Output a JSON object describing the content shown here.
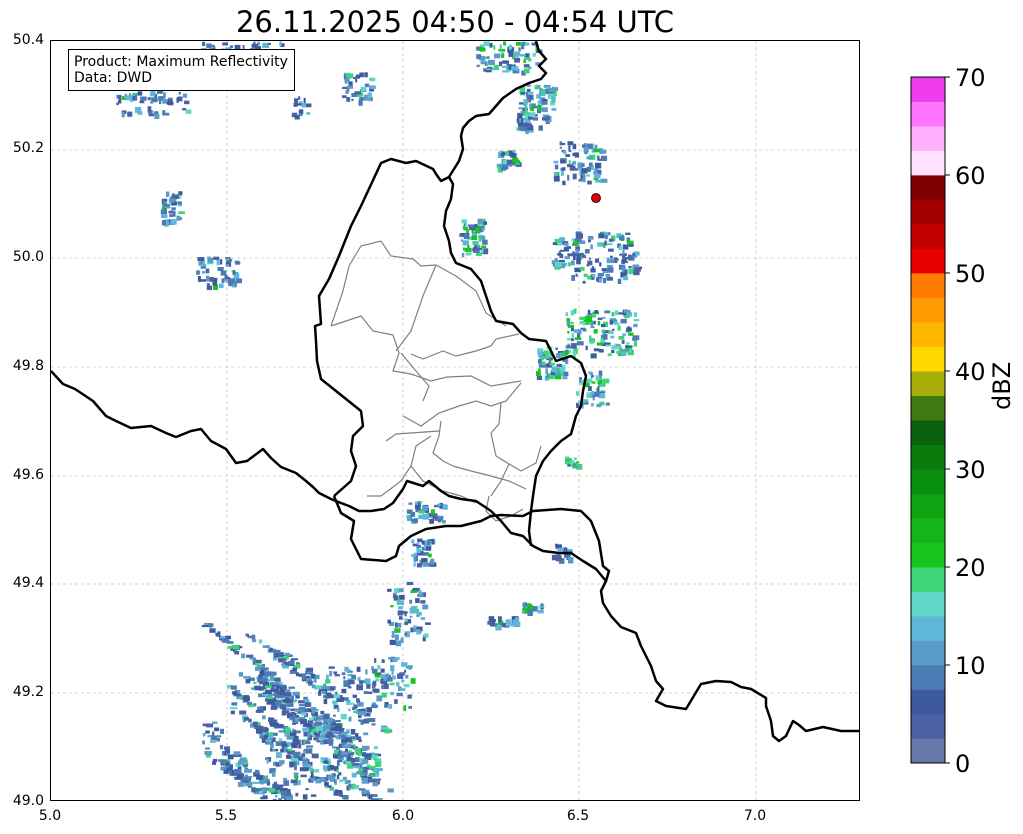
{
  "title": "26.11.2025 04:50 - 04:54 UTC",
  "info_box": {
    "line1": "Product: Maximum Reflectivity",
    "line2": "Data: DWD"
  },
  "map": {
    "lon_range": [
      5.0,
      7.3
    ],
    "lat_range": [
      49.0,
      50.4
    ],
    "lon_ticks": [
      "5.0",
      "5.5",
      "6.0",
      "6.5",
      "7.0"
    ],
    "lat_ticks": [
      "50.4",
      "50.2",
      "50.0",
      "49.8",
      "49.6",
      "49.4",
      "49.2",
      "49.0"
    ],
    "grid": true,
    "marker": {
      "lon": 6.54,
      "lat": 50.11,
      "color": "#e00000"
    }
  },
  "colorbar": {
    "unit": "dBZ",
    "min": 0,
    "max": 70,
    "step": 2.5,
    "labels": [
      "70",
      "60",
      "50",
      "40",
      "30",
      "20",
      "10",
      "0"
    ],
    "colors": [
      "#6677aa",
      "#4a62a4",
      "#3e5a9e",
      "#4c7bb4",
      "#5a9cc8",
      "#5eb7d8",
      "#5fd6c6",
      "#3ed47a",
      "#17c41e",
      "#13b61a",
      "#0ea311",
      "#0a8e0e",
      "#0a7a0c",
      "#0a610b",
      "#3f7a10",
      "#a8ae0a",
      "#ffd900",
      "#ffb700",
      "#ff9a00",
      "#ff7b00",
      "#e80000",
      "#c40000",
      "#a40000",
      "#7e0000",
      "#ffe0ff",
      "#ffb0ff",
      "#ff74ff",
      "#ef3cef"
    ]
  }
}
